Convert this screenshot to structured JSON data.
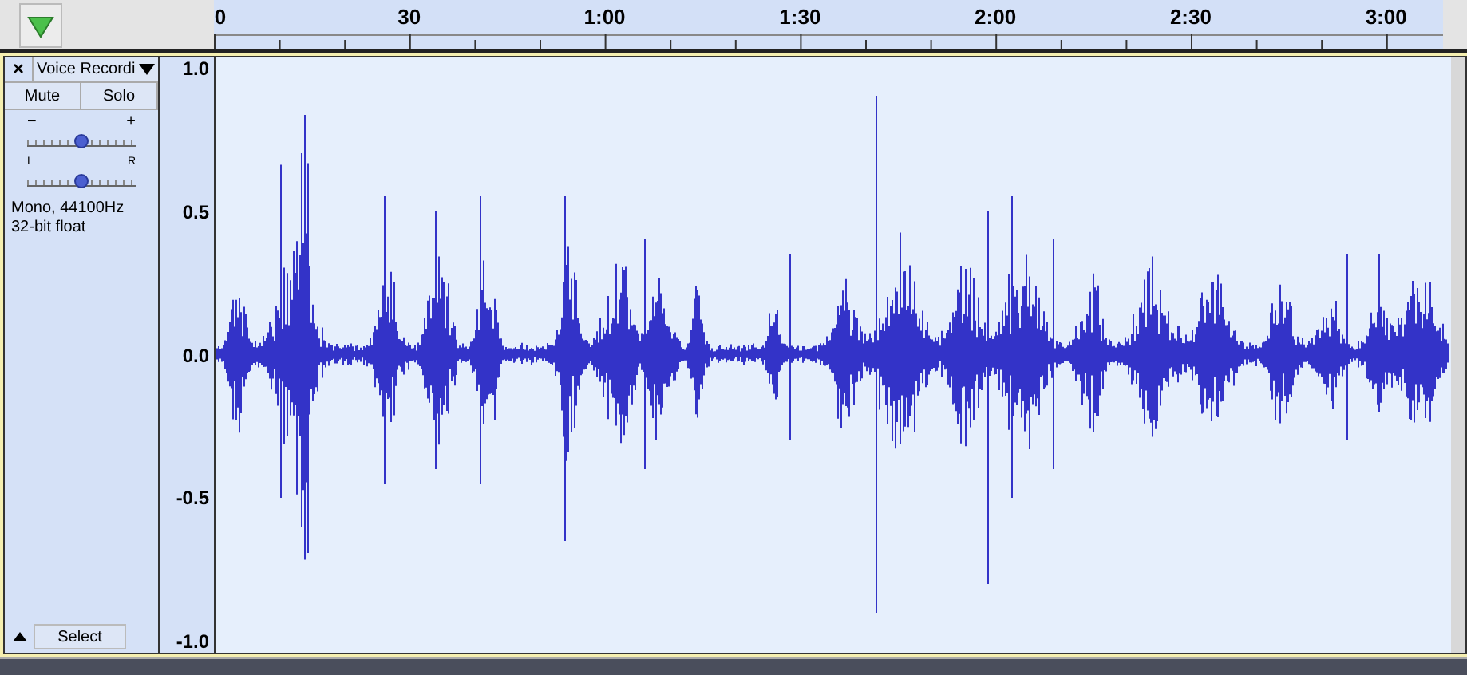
{
  "ruler": {
    "labels": [
      "0",
      "30",
      "1:00",
      "1:30",
      "2:00",
      "2:30",
      "3:00"
    ]
  },
  "track": {
    "close": "×",
    "name": "Voice Recordi",
    "mute": "Mute",
    "solo": "Solo",
    "gain": {
      "minus": "−",
      "plus": "+",
      "level": 0.5
    },
    "pan": {
      "left": "L",
      "right": "R",
      "level": 0.5
    },
    "info": [
      "Mono, 44100Hz",
      "32-bit float"
    ],
    "select": "Select",
    "scale": [
      "1.0",
      "0.5",
      "0.0",
      "-0.5",
      "-1.0"
    ]
  }
}
